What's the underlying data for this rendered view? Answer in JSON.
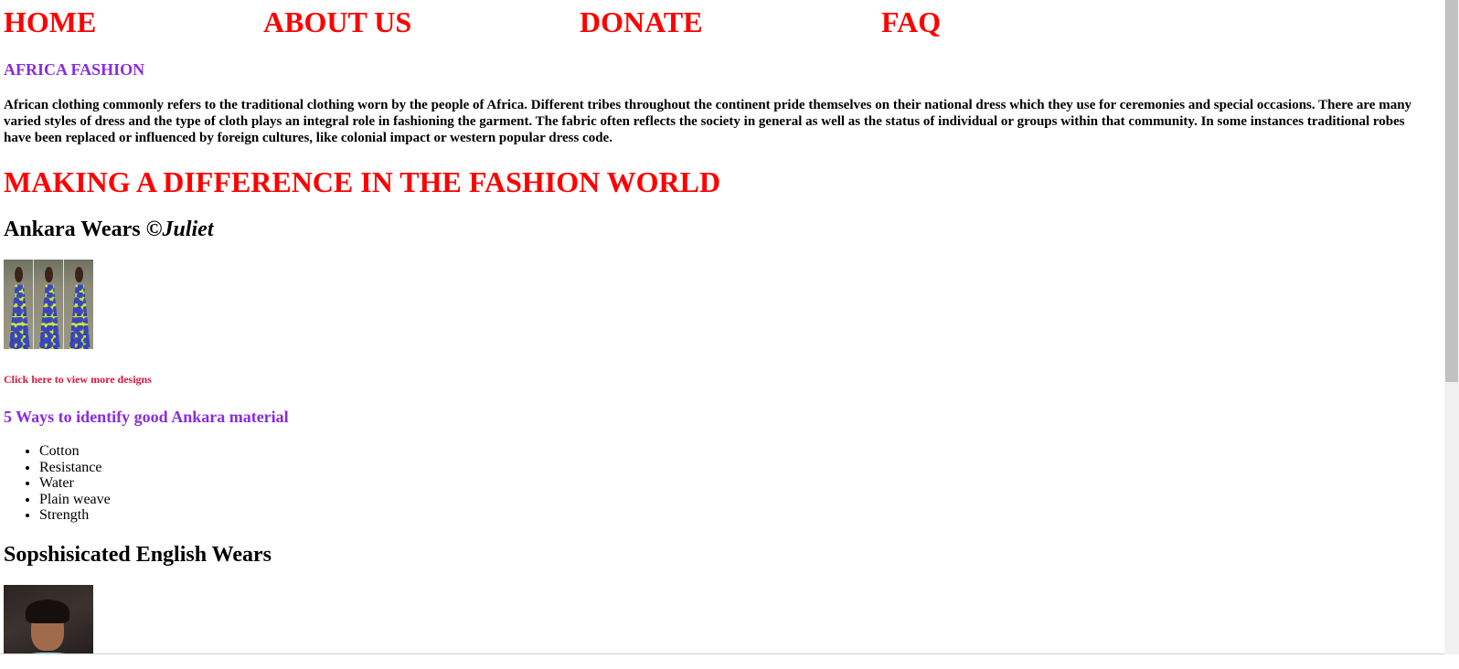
{
  "nav": {
    "items": [
      {
        "label": "HOME"
      },
      {
        "label": "ABOUT US"
      },
      {
        "label": "DONATE"
      },
      {
        "label": "FAQ"
      }
    ]
  },
  "section_title": "AFRICA FASHION",
  "intro_text": "African clothing commonly refers to the traditional clothing worn by the people of Africa. Different tribes throughout the continent pride themselves on their national dress which they use for ceremonies and special occasions. There are many varied styles of dress and the type of cloth plays an integral role in fashioning the garment. The fabric often reflects the society in general as well as the status of individual or groups within that community. In some instances traditional robes have been replaced or influenced by foreign cultures, like colonial impact or western popular dress code.",
  "main_heading": "MAKING A DIFFERENCE IN THE FASHION WORLD",
  "ankara": {
    "heading_prefix": "Ankara Wears ©",
    "heading_author": "Juliet",
    "view_more_link": "Click here to view more designs"
  },
  "ways": {
    "heading": "5 Ways to identify good Ankara material",
    "items": [
      "Cotton",
      "Resistance",
      "Water",
      "Plain weave",
      "Strength"
    ]
  },
  "english": {
    "heading": "Sopshisicated English Wears"
  },
  "colors": {
    "nav": "#ff0000",
    "section_title": "#8a2be2",
    "main_heading": "#ff0000",
    "link": "#dc143c"
  }
}
